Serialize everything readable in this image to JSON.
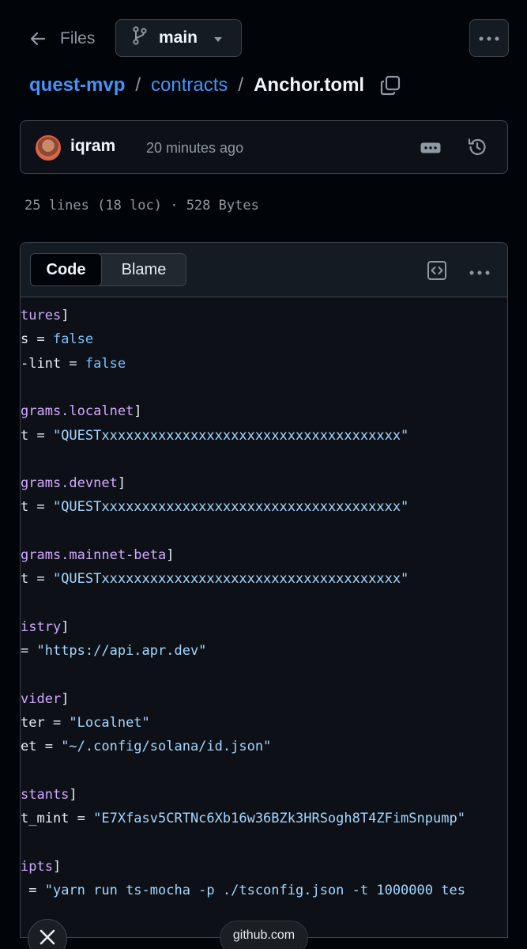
{
  "nav": {
    "back_label": "Files",
    "branch": "main"
  },
  "breadcrumb": {
    "repo": "quest-mvp",
    "folder": "contracts",
    "file": "Anchor.toml"
  },
  "commit": {
    "author": "iqram",
    "time": "20 minutes ago"
  },
  "file_meta": "25 lines (18 loc) · 528 Bytes",
  "code_view": {
    "tab_code": "Code",
    "tab_blame": "Blame"
  },
  "code_lines": [
    [
      {
        "t": "tures",
        "c": "sec"
      },
      {
        "t": "]",
        "c": "br"
      }
    ],
    [
      {
        "t": "s = ",
        "c": "key"
      },
      {
        "t": "false",
        "c": "bool"
      }
    ],
    [
      {
        "t": "-lint = ",
        "c": "key"
      },
      {
        "t": "false",
        "c": "bool"
      }
    ],
    [],
    [
      {
        "t": "grams.localnet",
        "c": "sec"
      },
      {
        "t": "]",
        "c": "br"
      }
    ],
    [
      {
        "t": "t = ",
        "c": "key"
      },
      {
        "t": "\"QUESTxxxxxxxxxxxxxxxxxxxxxxxxxxxxxxxxxxxxx\"",
        "c": "str"
      }
    ],
    [],
    [
      {
        "t": "grams.devnet",
        "c": "sec"
      },
      {
        "t": "]",
        "c": "br"
      }
    ],
    [
      {
        "t": "t = ",
        "c": "key"
      },
      {
        "t": "\"QUESTxxxxxxxxxxxxxxxxxxxxxxxxxxxxxxxxxxxxx\"",
        "c": "str"
      }
    ],
    [],
    [
      {
        "t": "grams.mainnet-beta",
        "c": "sec"
      },
      {
        "t": "]",
        "c": "br"
      }
    ],
    [
      {
        "t": "t = ",
        "c": "key"
      },
      {
        "t": "\"QUESTxxxxxxxxxxxxxxxxxxxxxxxxxxxxxxxxxxxxx\"",
        "c": "str"
      }
    ],
    [],
    [
      {
        "t": "istry",
        "c": "sec"
      },
      {
        "t": "]",
        "c": "br"
      }
    ],
    [
      {
        "t": "= ",
        "c": "key"
      },
      {
        "t": "\"https://api.apr.dev\"",
        "c": "str"
      }
    ],
    [],
    [
      {
        "t": "vider",
        "c": "sec"
      },
      {
        "t": "]",
        "c": "br"
      }
    ],
    [
      {
        "t": "ter = ",
        "c": "key"
      },
      {
        "t": "\"Localnet\"",
        "c": "str"
      }
    ],
    [
      {
        "t": "et = ",
        "c": "key"
      },
      {
        "t": "\"~/.config/solana/id.json\"",
        "c": "str"
      }
    ],
    [],
    [
      {
        "t": "stants",
        "c": "sec"
      },
      {
        "t": "]",
        "c": "br"
      }
    ],
    [
      {
        "t": "t_mint = ",
        "c": "key"
      },
      {
        "t": "\"E7Xfasv5CRTNc6Xb16w36BZk3HRSogh8T4ZFimSnpump\"",
        "c": "str"
      }
    ],
    [],
    [
      {
        "t": "ipts",
        "c": "sec"
      },
      {
        "t": "]",
        "c": "br"
      }
    ],
    [
      {
        "t": " = ",
        "c": "key"
      },
      {
        "t": "\"yarn run ts-mocha -p ./tsconfig.json -t 1000000 tes",
        "c": "str"
      }
    ]
  ],
  "bottom": {
    "url": "github.com"
  },
  "icons": [
    "arrow-left-icon",
    "git-branch-icon",
    "triangle-down-icon",
    "kebab-horizontal-icon",
    "copy-icon",
    "history-icon",
    "code-square-icon",
    "close-icon"
  ],
  "colors": {
    "link": "#4493f8",
    "section": "#d2a8ff",
    "boolean": "#79c0ff",
    "string": "#a5d6ff"
  }
}
